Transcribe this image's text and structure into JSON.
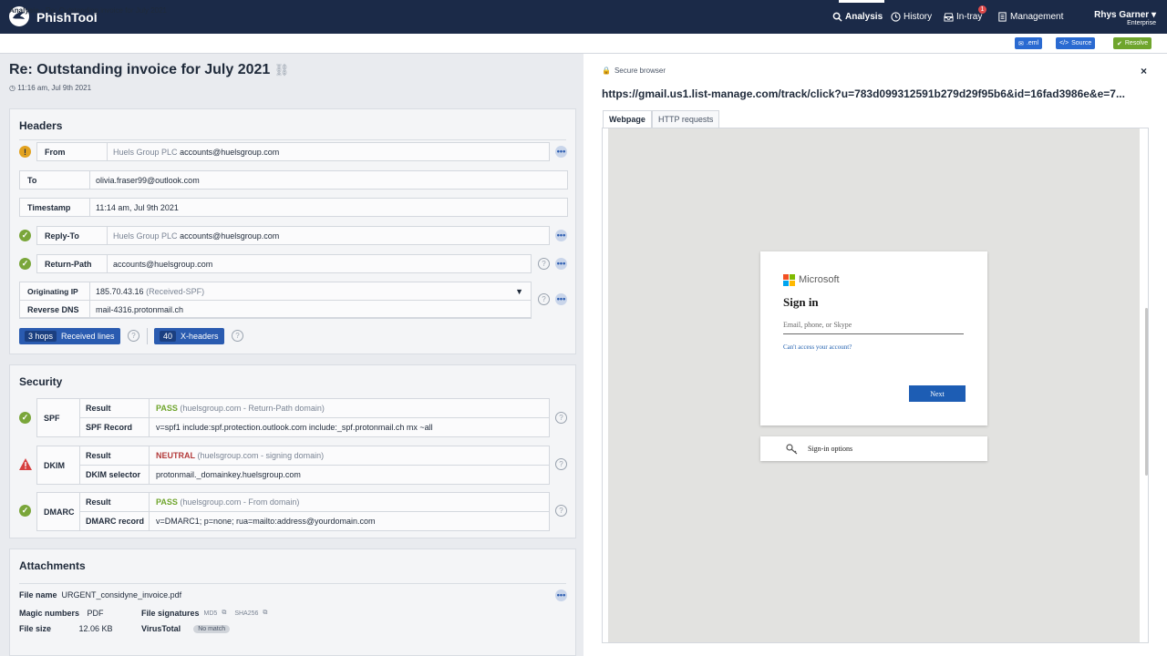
{
  "app": {
    "name": "PhishTool"
  },
  "nav": {
    "analysis": "Analysis",
    "history": "History",
    "intray": "In-tray",
    "intray_count": "1",
    "management": "Management"
  },
  "user": {
    "name": "Rhys Garner",
    "role": "Enterprise"
  },
  "breadcrumb": {
    "root": "Analysis",
    "current": "Re: Outstanding invoice for July 2021"
  },
  "toolbar": {
    "eml": ".eml",
    "source": "Source",
    "resolve": "Resolve"
  },
  "email": {
    "subject": "Re: Outstanding invoice for July 2021",
    "received": "11:16 am, Jul 9th 2021"
  },
  "headers": {
    "title": "Headers",
    "from": {
      "label": "From",
      "name": "Huels Group PLC",
      "address": "accounts@huelsgroup.com"
    },
    "to": {
      "label": "To",
      "value": "olivia.fraser99@outlook.com"
    },
    "timestamp": {
      "label": "Timestamp",
      "value": "11:14 am, Jul 9th 2021"
    },
    "reply_to": {
      "label": "Reply-To",
      "name": "Huels Group PLC",
      "address": "accounts@huelsgroup.com"
    },
    "return_path": {
      "label": "Return-Path",
      "value": "accounts@huelsgroup.com"
    },
    "originating_ip": {
      "label": "Originating IP",
      "value": "185.70.43.16",
      "note": "(Received-SPF)"
    },
    "reverse_dns": {
      "label": "Reverse DNS",
      "value": "mail-4316.protonmail.ch"
    },
    "received": {
      "count": "3 hops",
      "label": "Received lines"
    },
    "xheaders": {
      "count": "40",
      "label": "X-headers"
    }
  },
  "security": {
    "title": "Security",
    "spf": {
      "name": "SPF",
      "result_label": "Result",
      "result": "PASS",
      "result_note": "(huelsgroup.com - Return-Path domain)",
      "record_label": "SPF Record",
      "record": "v=spf1 include:spf.protection.outlook.com include:_spf.protonmail.ch mx ~all"
    },
    "dkim": {
      "name": "DKIM",
      "result_label": "Result",
      "result": "NEUTRAL",
      "result_note": "(huelsgroup.com - signing domain)",
      "record_label": "DKIM selector",
      "record": "protonmail._domainkey.huelsgroup.com"
    },
    "dmarc": {
      "name": "DMARC",
      "result_label": "Result",
      "result": "PASS",
      "result_note": "(huelsgroup.com - From domain)",
      "record_label": "DMARC record",
      "record": "v=DMARC1; p=none; rua=mailto:address@yourdomain.com"
    }
  },
  "attachments": {
    "title": "Attachments",
    "file_name_label": "File name",
    "file_name": "URGENT_considyne_invoice.pdf",
    "magic_label": "Magic numbers",
    "magic": "PDF",
    "signatures_label": "File signatures",
    "md5": "MD5",
    "sha256": "SHA256",
    "size_label": "File size",
    "size": "12.06 KB",
    "vt_label": "VirusTotal",
    "vt": "No match"
  },
  "browser": {
    "secure_label": "Secure browser",
    "url": "https://gmail.us1.list-manage.com/track/click?u=783d099312591b279d29f95b6&id=16fad3986e&e=7...",
    "tabs": [
      "Webpage",
      "HTTP requests"
    ],
    "page": {
      "brand": "Microsoft",
      "heading": "Sign in",
      "email_placeholder": "Email, phone, or Skype",
      "cant_access": "Can't access your account?",
      "next": "Next",
      "signin_options": "Sign-in options"
    }
  },
  "colors": {
    "nav_bg": "#1b2a48",
    "accent_blue": "#2a5bb0",
    "pass": "#6fa52d",
    "neutral": "#b33a3a"
  }
}
